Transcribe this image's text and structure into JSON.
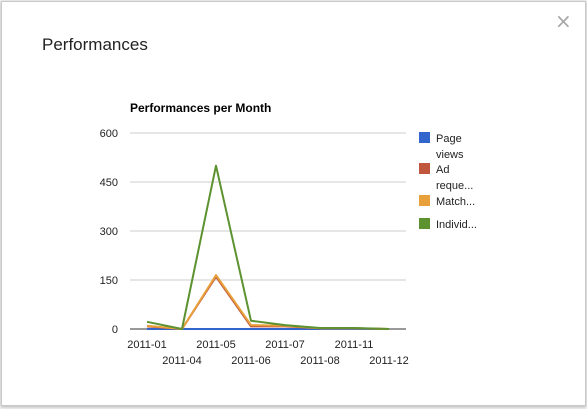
{
  "dialog": {
    "title": "Performances",
    "close_symbol": "×",
    "close_icon": "close-icon"
  },
  "chart_data": {
    "type": "line",
    "title": "Performances per Month",
    "xlabel": "",
    "ylabel": "",
    "ylim": [
      0,
      600
    ],
    "yticks": [
      "600",
      "450",
      "300",
      "150",
      "0"
    ],
    "categories": [
      "2011-01",
      "2011-04",
      "2011-05",
      "2011-06",
      "2011-07",
      "2011-08",
      "2011-11",
      "2011-12"
    ],
    "series": [
      {
        "name": "Page views",
        "legend_label": [
          "Page",
          "views"
        ],
        "color": "#3366cc",
        "values": [
          0,
          0,
          0,
          0,
          0,
          0,
          0,
          0
        ]
      },
      {
        "name": "Ad requests",
        "legend_label": [
          "Ad",
          "reque..."
        ],
        "color": "#c0563c",
        "values": [
          8,
          0,
          160,
          8,
          8,
          2,
          2,
          0
        ]
      },
      {
        "name": "Matched",
        "legend_label": [
          "Match..."
        ],
        "color": "#e8a13a",
        "values": [
          10,
          0,
          165,
          12,
          10,
          2,
          2,
          0
        ]
      },
      {
        "name": "Individual",
        "legend_label": [
          "Individ..."
        ],
        "color": "#5c9230",
        "values": [
          22,
          0,
          500,
          25,
          12,
          3,
          3,
          0
        ]
      }
    ],
    "grid": true,
    "legend": "right"
  }
}
